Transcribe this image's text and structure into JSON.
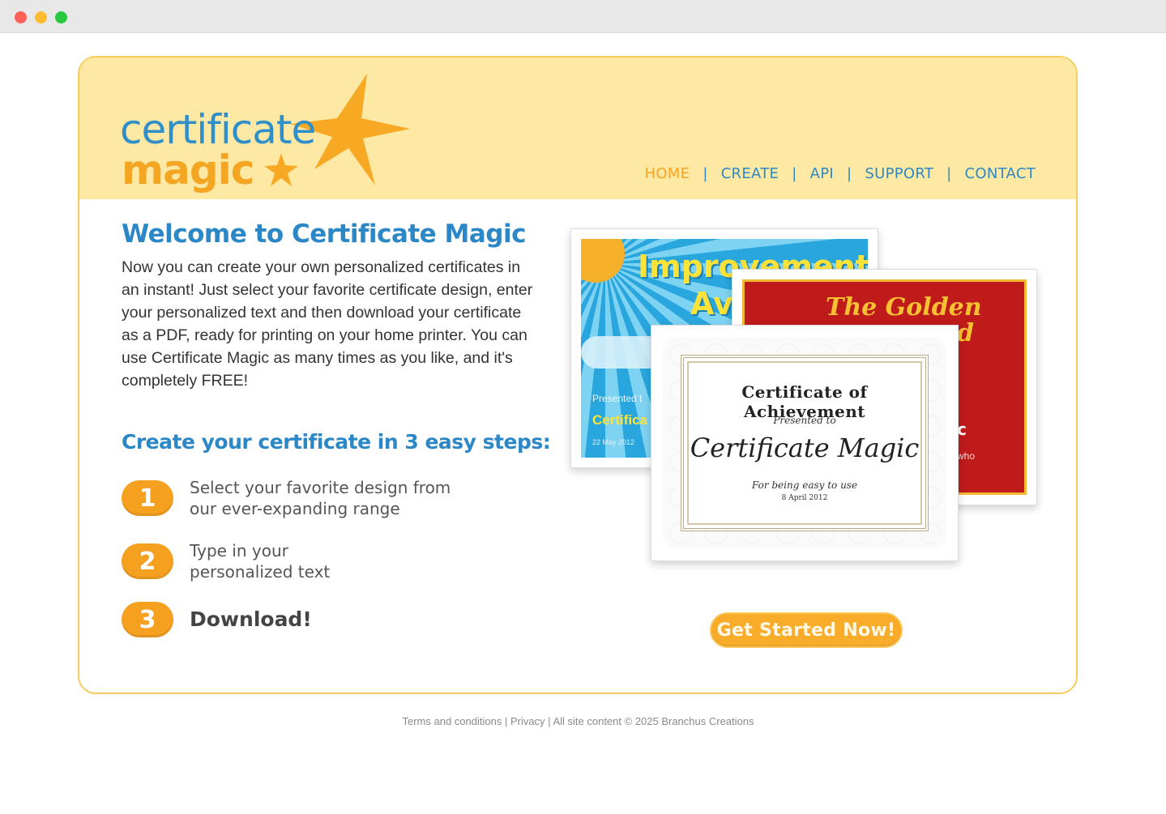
{
  "logo": {
    "line1": "certificate",
    "line2": "magic"
  },
  "nav": {
    "items": [
      {
        "label": "HOME",
        "active": true
      },
      {
        "label": "CREATE"
      },
      {
        "label": "API"
      },
      {
        "label": "SUPPORT"
      },
      {
        "label": "CONTACT"
      }
    ],
    "separator": "|"
  },
  "welcome": {
    "title": "Welcome to Certificate Magic",
    "text": "Now you can create your own personalized certificates in an instant! Just select your favorite certificate design, enter your personalized text and then download your certificate as a PDF, ready for printing on your home printer. You can use Certificate Magic as many times as you like, and it's completely FREE!"
  },
  "steps": {
    "title": "Create your certificate in 3 easy steps:",
    "items": [
      {
        "number": "1",
        "text": "Select your favorite design from our ever-expanding range"
      },
      {
        "number": "2",
        "text": "Type in your personalized text"
      },
      {
        "number": "3",
        "text": "Download!"
      }
    ]
  },
  "certificates": {
    "blue": {
      "title1": "Improvement",
      "title2": "Av",
      "presented": "Presented t",
      "name": "Certifica",
      "date": "22 May 2012"
    },
    "red": {
      "title1": "The Golden",
      "title2": "d",
      "c": "c",
      "who": "who"
    },
    "achievement": {
      "title": "Certificate of Achievement",
      "presented": "Presented to",
      "name": "Certificate Magic",
      "for": "For being easy to use",
      "date": "8 April 2012"
    }
  },
  "cta": {
    "label": "Get Started Now!"
  },
  "footer": {
    "terms": "Terms and conditions",
    "privacy": "Privacy",
    "copyright": "All site content © 2025 Branchus Creations",
    "separator": " | "
  },
  "colors": {
    "accent_blue": "#2c87c6",
    "accent_orange": "#f6a020",
    "header_bg": "#fde8a4",
    "border": "#f6cd5c"
  }
}
